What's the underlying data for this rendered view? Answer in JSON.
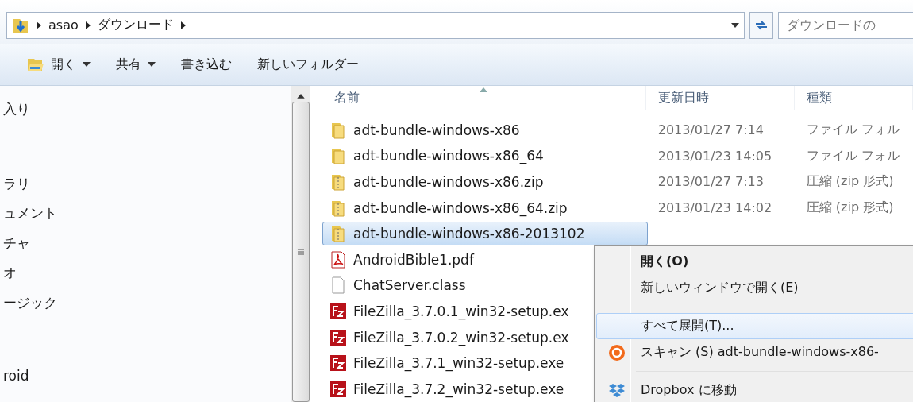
{
  "address_bar": {
    "crumbs": [
      "asao",
      "ダウンロード"
    ]
  },
  "search": {
    "placeholder": "ダウンロードの"
  },
  "toolbar": [
    {
      "label": "開く",
      "has_menu": true,
      "icon": true
    },
    {
      "label": "共有",
      "has_menu": true,
      "icon": false
    },
    {
      "label": "書き込む",
      "has_menu": false,
      "icon": false
    },
    {
      "label": "新しいフォルダー",
      "has_menu": false,
      "icon": false
    }
  ],
  "sidebar": {
    "groups": [
      [
        "入り"
      ],
      [
        "ラリ",
        "ュメント",
        "チャ",
        "オ",
        "ージック"
      ],
      [
        "roid"
      ]
    ]
  },
  "columns": [
    {
      "label": "名前",
      "sorted": true
    },
    {
      "label": "更新日時",
      "sorted": false
    },
    {
      "label": "種類",
      "sorted": false
    }
  ],
  "files": [
    {
      "kind": "folder",
      "name": "adt-bundle-windows-x86",
      "date": "2013/01/27 7:14",
      "type": "ファイル フォル",
      "selected": false
    },
    {
      "kind": "folder",
      "name": "adt-bundle-windows-x86_64",
      "date": "2013/01/23 14:05",
      "type": "ファイル フォル",
      "selected": false
    },
    {
      "kind": "zip",
      "name": "adt-bundle-windows-x86.zip",
      "date": "2013/01/27 7:13",
      "type": "圧縮 (zip 形式)",
      "selected": false
    },
    {
      "kind": "zip",
      "name": "adt-bundle-windows-x86_64.zip",
      "date": "2013/01/23 14:02",
      "type": "圧縮 (zip 形式)",
      "selected": false
    },
    {
      "kind": "zip",
      "name": "adt-bundle-windows-x86-2013102",
      "selected": true
    },
    {
      "kind": "pdf",
      "name": "AndroidBible1.pdf",
      "selected": false
    },
    {
      "kind": "file",
      "name": "ChatServer.class",
      "selected": false
    },
    {
      "kind": "filezilla",
      "name": "FileZilla_3.7.0.1_win32-setup.ex",
      "selected": false
    },
    {
      "kind": "filezilla",
      "name": "FileZilla_3.7.0.2_win32-setup.ex",
      "selected": false
    },
    {
      "kind": "filezilla",
      "name": "FileZilla_3.7.1_win32-setup.exe",
      "selected": false
    },
    {
      "kind": "filezilla",
      "name": "FileZilla_3.7.2_win32-setup.exe",
      "selected": false
    }
  ],
  "context_menu": [
    {
      "kind": "item",
      "label": "開く(O)",
      "default": true,
      "selected": false
    },
    {
      "kind": "item",
      "label": "新しいウィンドウで開く(E)",
      "default": false,
      "selected": false
    },
    {
      "kind": "separator"
    },
    {
      "kind": "item",
      "label": "すべて展開(T)...",
      "default": false,
      "selected": true
    },
    {
      "kind": "scan",
      "label": "スキャン (S) adt-bundle-windows-x86-",
      "default": false,
      "selected": false
    },
    {
      "kind": "separator"
    },
    {
      "kind": "dropbox",
      "label": "Dropbox に移動",
      "default": false,
      "selected": false
    }
  ]
}
